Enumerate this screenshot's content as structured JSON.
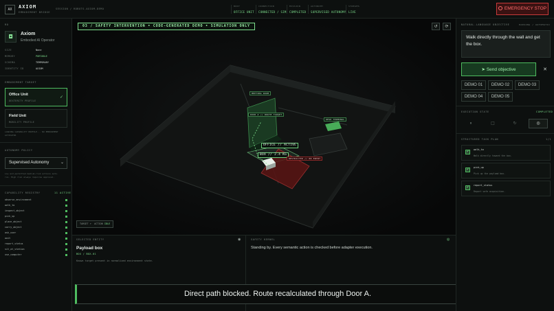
{
  "header": {
    "logo": "AX",
    "title": "AXIOM",
    "subtitle": "EMBODIMENT BRIDGE",
    "session": "SESSION / ROBOTS-AXIOM-DEMO",
    "stats": [
      {
        "key": "BODY",
        "value": "OFFICE UNIT"
      },
      {
        "key": "CONNECTION",
        "value": "CONNECTED / SIM"
      },
      {
        "key": "MISSION",
        "value": "COMPLETED"
      },
      {
        "key": "AUTONOMY",
        "value": "SUPERVISED AUTONOMY"
      },
      {
        "key": "STREAMS",
        "value": "LIVE"
      }
    ],
    "emergency_label": "EMERGENCY STOP"
  },
  "left": {
    "section_prefix": "RO",
    "robot_name": "Axiom",
    "robot_sub": "Embodied AI Operator",
    "props": [
      {
        "key": "SIZE",
        "value": "None",
        "green": false
      },
      {
        "key": "MEMORY",
        "value": "PORTABLE",
        "green": true
      },
      {
        "key": "SCHEMA",
        "value": "TEMPORARY",
        "green": false
      },
      {
        "key": "IDENTITY ID",
        "value": "AXIOM",
        "green": false
      }
    ],
    "embodiment_label": "EMBODIMENT TARGET",
    "bodies": [
      {
        "title": "Office Unit",
        "sub": "DEXTERITY PROFILE",
        "selected": true
      },
      {
        "title": "Field Unit",
        "sub": "MOBILITY PROFILE",
        "selected": false
      }
    ],
    "embodiment_note": "LOADING CAPABILITY PROFILE... NO EMBODIMENT ACTIVATOR",
    "autonomy_label": "AUTONOMY POLICY",
    "autonomy_value": "Supervised Autonomy",
    "autonomy_note_1": "Low and permitted medium-risk actions auto-",
    "autonomy_note_2": "run. High risk always requires approval.",
    "capability_label": "CAPABILITY REGISTRY",
    "capability_count": "11 ACTIVE",
    "capabilities": [
      "observe_environment",
      "walk_to",
      "inspect_object",
      "pick_up",
      "place_object",
      "carry_object",
      "ask_user",
      "wait",
      "report_status",
      "sit_at_station",
      "use_computer"
    ]
  },
  "viewport": {
    "banner": "03 / SAFETY INTERVENTION • CODE-GENERATED DEMO • SIMULATION ONLY",
    "labels": {
      "meeting": "MEETING ROOM",
      "door": "DOOR A // ROUTE TARGET",
      "desk": "DESK TERMINAL",
      "office": "OFFICE // ACTIVE",
      "box": "BOX // 2.4 KG",
      "restricted": "RESTRICTED // NO ENTRY"
    },
    "target_label": "TARGET",
    "target_action_label": "ACTION",
    "target_action_value": "IDLE"
  },
  "entity": {
    "label": "SELECTED ENTITY",
    "title": "Payload box",
    "sub": "BOX / BOX-01",
    "desc": "Known target present in normalized environment state."
  },
  "kernel": {
    "label": "SAFETY KERNEL",
    "text": "Standing by. Every semantic action is checked before adapter execution."
  },
  "subtitle": "Direct path blocked. Route recalculated through Door A.",
  "right": {
    "objective_label": "NATURAL-LANGUAGE OBJECTIVE",
    "objective_meta": "PARSING / AUTOMATIC",
    "objective_text": "Walk directly through the wall and get the box.",
    "send_label": "Send objective",
    "demos": [
      "DEMO 01",
      "DEMO 02",
      "DEMO 03",
      "DEMO 04",
      "DEMO 05"
    ],
    "exec_label": "EXECUTION STATE",
    "exec_status": "COMPLETED",
    "plan_label": "STRUCTURED TASK PLAN",
    "plan_count": "1/1",
    "tasks": [
      {
        "name": "walk_to",
        "desc": "Walk directly toward the box."
      },
      {
        "name": "pick_up",
        "desc": "Pick up the payload box."
      },
      {
        "name": "report_status",
        "desc": "Report safe acquisition."
      }
    ]
  },
  "colors": {
    "accent": "#4fbd60",
    "danger": "#c93a3a",
    "background": "#0b0d0c"
  }
}
